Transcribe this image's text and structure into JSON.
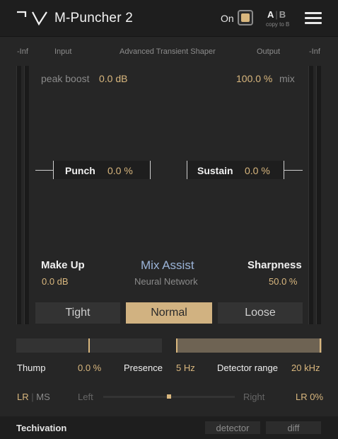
{
  "header": {
    "title": "M-Puncher 2",
    "on_label": "On",
    "ab_a": "A",
    "ab_sep": "|",
    "ab_b": "B",
    "copy_to_b": "copy to B",
    "icons": {
      "logo": "mv-logo",
      "menu": "hamburger-menu-icon"
    }
  },
  "labels": {
    "inf_left": "-Inf",
    "input": "Input",
    "subtitle": "Advanced Transient Shaper",
    "output": "Output",
    "inf_right": "-Inf"
  },
  "panel": {
    "peak_boost_label": "peak boost",
    "peak_boost_value": "0.0 dB",
    "mix_value": "100.0 %",
    "mix_label": "mix",
    "punch_label": "Punch",
    "punch_value": "0.0 %",
    "sustain_label": "Sustain",
    "sustain_value": "0.0 %",
    "makeup_label": "Make Up",
    "makeup_value": "0.0 dB",
    "mix_assist_label": "Mix Assist",
    "neural_network_label": "Neural Network",
    "sharpness_label": "Sharpness",
    "sharpness_value": "50.0 %"
  },
  "modes": {
    "tight": "Tight",
    "normal": "Normal",
    "loose": "Loose",
    "selected": "Normal"
  },
  "lower": {
    "thump_label": "Thump",
    "thump_value": "0.0 %",
    "presence_label": "Presence",
    "presence_value": "5 Hz",
    "detector_range_label": "Detector range",
    "detector_range_value": "20 kHz",
    "lr_label": "LR",
    "lr_sep": "|",
    "ms_label": "MS",
    "left_label": "Left",
    "right_label": "Right",
    "pan_value": "LR 0%"
  },
  "footer": {
    "brand": "Techivation",
    "detector": "detector",
    "diff": "diff"
  },
  "colors": {
    "accent": "#d9b77e",
    "background": "#262626",
    "mix_assist": "#9bb4d8"
  }
}
